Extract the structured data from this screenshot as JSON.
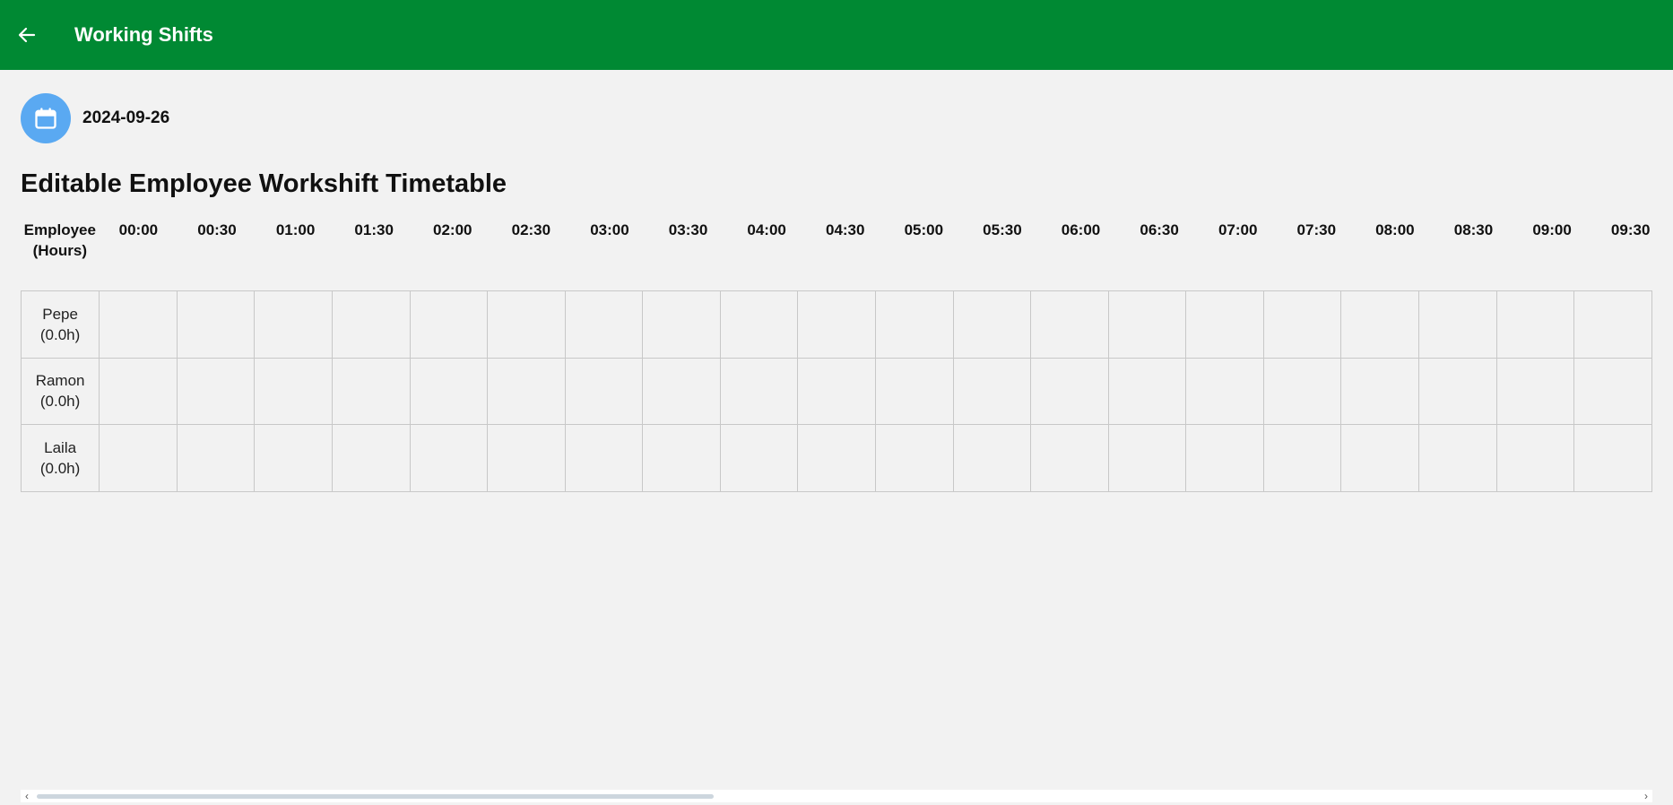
{
  "appbar": {
    "title": "Working Shifts",
    "back_icon": "arrow-left-icon",
    "color": "#008933"
  },
  "date_picker": {
    "icon": "calendar-icon",
    "value": "2024-09-26",
    "color": "#5aa9f2"
  },
  "page_title": "Editable Employee Workshift Timetable",
  "timetable": {
    "employee_header_line1": "Employee",
    "employee_header_line2": "(Hours)",
    "time_slots": [
      "00:00",
      "00:30",
      "01:00",
      "01:30",
      "02:00",
      "02:30",
      "03:00",
      "03:30",
      "04:00",
      "04:30",
      "05:00",
      "05:30",
      "06:00",
      "06:30",
      "07:00",
      "07:30",
      "08:00",
      "08:30",
      "09:00",
      "09:30"
    ],
    "rows": [
      {
        "name": "Pepe",
        "hours": "(0.0h)"
      },
      {
        "name": "Ramon",
        "hours": "(0.0h)"
      },
      {
        "name": "Laila",
        "hours": "(0.0h)"
      }
    ]
  },
  "scrollbar": {
    "left_arrow": "‹",
    "right_arrow": "›"
  }
}
